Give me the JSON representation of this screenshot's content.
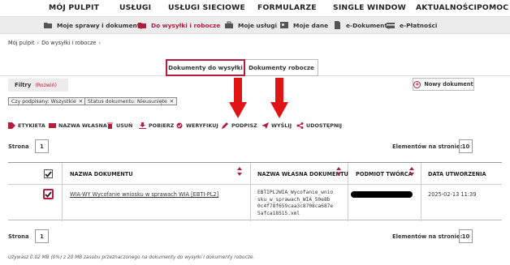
{
  "top_nav": [
    "MÓJ PULPIT",
    "USŁUGI",
    "USŁUGI SIECIOWE",
    "FORMULARZE",
    "SINGLE WINDOW",
    "AKTUALNOŚCI",
    "POMOC"
  ],
  "sub_nav": [
    {
      "label": "Moje sprawy i dokumenty",
      "icon": "folder-icon",
      "active": false
    },
    {
      "label": "Do wysyłki i robocze",
      "icon": "folder-outgoing-icon",
      "active": true
    },
    {
      "label": "Moje usługi",
      "icon": "briefcase-icon",
      "active": false
    },
    {
      "label": "Moje dane",
      "icon": "person-card-icon",
      "active": false
    },
    {
      "label": "e-Dokumenty",
      "icon": "document-icon",
      "active": false
    },
    {
      "label": "e-Płatności",
      "icon": "payment-icon",
      "active": false
    }
  ],
  "breadcrumb": [
    "Mój pulpit",
    "Do wysyłki i robocze"
  ],
  "tabs": [
    {
      "label": "Dokumenty do wysyłki",
      "active": true
    },
    {
      "label": "Dokumenty robocze",
      "active": false
    }
  ],
  "filters": {
    "label": "Filtry",
    "toggle": "(Rozwiń)"
  },
  "new_document_label": "Nowy dokument",
  "chips": [
    "Czy podpisany: Wszystkie",
    "Status dokumentu: Nieusunięte"
  ],
  "actions": [
    "ETYKIETA",
    "NAZWA WŁASNA",
    "USUŃ",
    "POBIERZ",
    "WERYFIKUJ",
    "PODPISZ",
    "WYŚLIJ",
    "UDOSTĘPNIJ"
  ],
  "pager": {
    "label": "Strona",
    "page": "1",
    "per_page_label": "Elementów na stronie:",
    "per_page": "10"
  },
  "table": {
    "headers": [
      "NAZWA DOKUMENTU",
      "NAZWA WŁASNA DOKUMENTU",
      "PODMIOT TWÓRCA",
      "DATA UTWORZENIA"
    ],
    "rows": [
      {
        "name": "WIA-WY Wycofanie wniosku w sprawach WIA [EBTI-PL2]",
        "own_name": "EBTIPL2WIA_Wycofanie_wnio\nsku_w_sprawach_WIA_50e8b\n0c4f78f659caa3c8708ca687e\n5afca18515.xml",
        "creator": "",
        "date": "2025-02-13 11:39",
        "checked": true
      }
    ]
  },
  "footer_note": "Używasz 0.02 MB (0%) z 20 MB zasobu przeznaczonego na dokumenty do wysyłki i dokumenty robocze.",
  "colors": {
    "accent": "#b41e3c",
    "annotation_arrow": "#e01414"
  }
}
